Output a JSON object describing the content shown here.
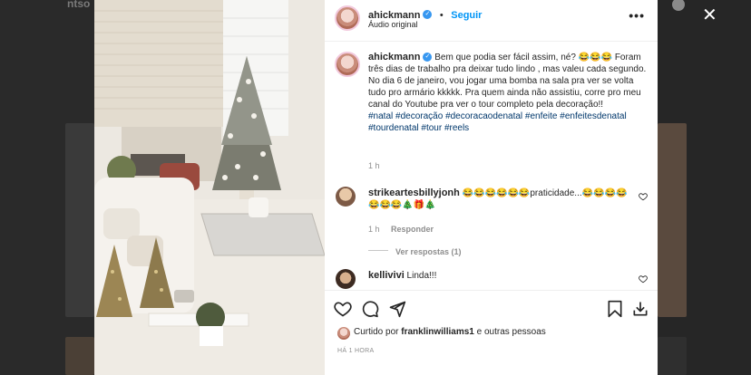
{
  "background": {
    "partial_text": "ntso",
    "tile_colors": [
      "#3a3a3a",
      "#5a4a3e",
      "#4b4036",
      "#2f2f2f"
    ]
  },
  "close_icon": "close-icon",
  "post": {
    "author": "ahickmann",
    "follow_label": "Seguir",
    "audio_label": "Áudio original",
    "more_icon": "more-options-icon",
    "caption_first": "Bem que podia ser fácil assim, né? 😂😂😂",
    "caption_body": "Foram três dias de trabalho pra deixar tudo lindo , mas valeu cada segundo. No dia 6 de janeiro, vou jogar uma bomba na sala pra ver se volta tudo pro armário kkkkk. Pra quem ainda não assistiu, corre pro meu canal do Youtube pra ver o tour completo pela decoração!!",
    "hashtags": "#natal #decoração #decoracaodenatal #enfeite #enfeitesdenatal #tourdenatal #tour #reels",
    "caption_time": "1 h"
  },
  "comments": [
    {
      "user": "strikeartesbillyjonh",
      "text": "😂😂😂😂😂😂praticidade...😂😂😂😂😂😂😂🎄🎁🎄",
      "time": "1 h",
      "reply_label": "Responder",
      "view_replies": "Ver respostas (1)"
    },
    {
      "user": "kellivivi",
      "text": "Linda!!!"
    }
  ],
  "actions": {
    "like_icon": "heart-icon",
    "comment_icon": "comment-icon",
    "share_icon": "share-icon",
    "save_icon": "bookmark-icon"
  },
  "likes": {
    "prefix": "Curtido por",
    "user": "franklinwilliams1",
    "suffix": "e outras pessoas"
  },
  "post_time": "HÁ 1 HORA",
  "colors": {
    "link_blue": "#0095f6",
    "hashtag_blue": "#00376b",
    "muted_gray": "#8e8e8e"
  }
}
